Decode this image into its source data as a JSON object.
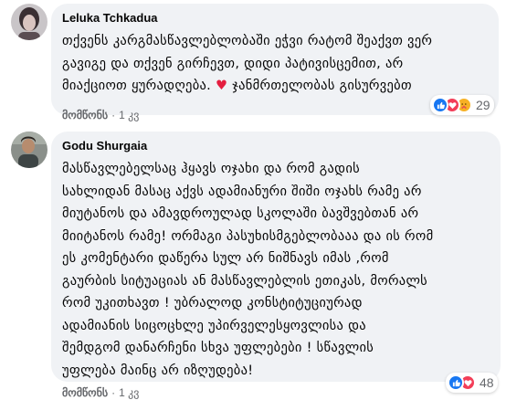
{
  "comments": [
    {
      "author": "Leluka Tchkadua",
      "text_lines": [
        "თქვენს კარგმასწავლებლობაში ეჭვი რატომ შეაქვთ ვერ",
        "გავიგე და თქვენ გირჩევთ, დიდი პატივისცემით, არ",
        "მიაქციოთ ყურადღება."
      ],
      "heart": "♥",
      "text_tail": "ჯანმრთელობას გისურვებთ",
      "reaction_count": "29",
      "like_label": "მომწონს",
      "time": "1 კვ"
    },
    {
      "author": "Godu Shurgaia",
      "text_lines": [
        "მასწავლებელსაც ჰყავს ოჯახი და რომ გადის",
        "სახლიდან მასაც აქვს ადამიანური შიში ოჯახს რამე არ",
        "მიუტანოს და ამავდროულად სკოლაში ბავშვებთან არ",
        "მიიტანოს რამე! ორმაგი პასუხისმგებლობააა და ის რომ",
        "ეს კომენტარი დაწერა სულ არ ნიშნავს იმას ,რომ",
        "გაურბის სიტუაციას ან მასწავლებლის ეთიკას, მორალს",
        "რომ უკითხავთ ! უბრალოდ კონსტიტუციურად",
        "ადამიანის სიცოცხლე უპირველესყოვლისა და",
        "შემდგომ დანარჩენი სხვა უფლებები ! სწავლის",
        "უფლება მაინც არ იზღუდება!"
      ],
      "reaction_count": "48",
      "like_label": "მომწონს",
      "time": "1 კვ"
    }
  ]
}
